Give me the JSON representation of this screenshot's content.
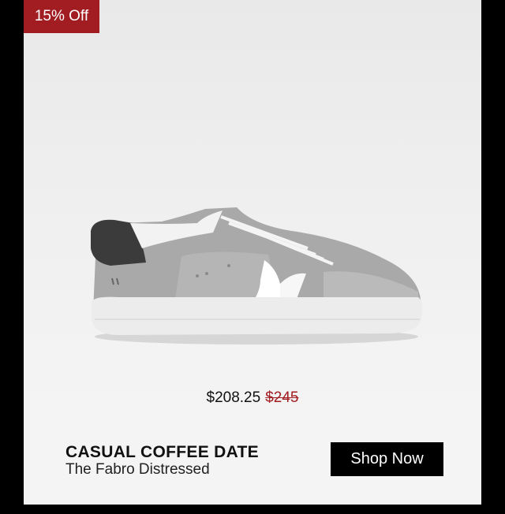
{
  "badge": {
    "label": "15% Off"
  },
  "price": {
    "current": "$208.25",
    "original": "$245"
  },
  "product": {
    "title": "CASUAL COFFEE DATE",
    "subtitle": "The Fabro Distressed"
  },
  "cta": {
    "label": "Shop Now"
  },
  "colors": {
    "badge_bg": "#a11d22",
    "sale_price": "#a11d22",
    "button_bg": "#000000",
    "card_bg": "#efefef"
  }
}
